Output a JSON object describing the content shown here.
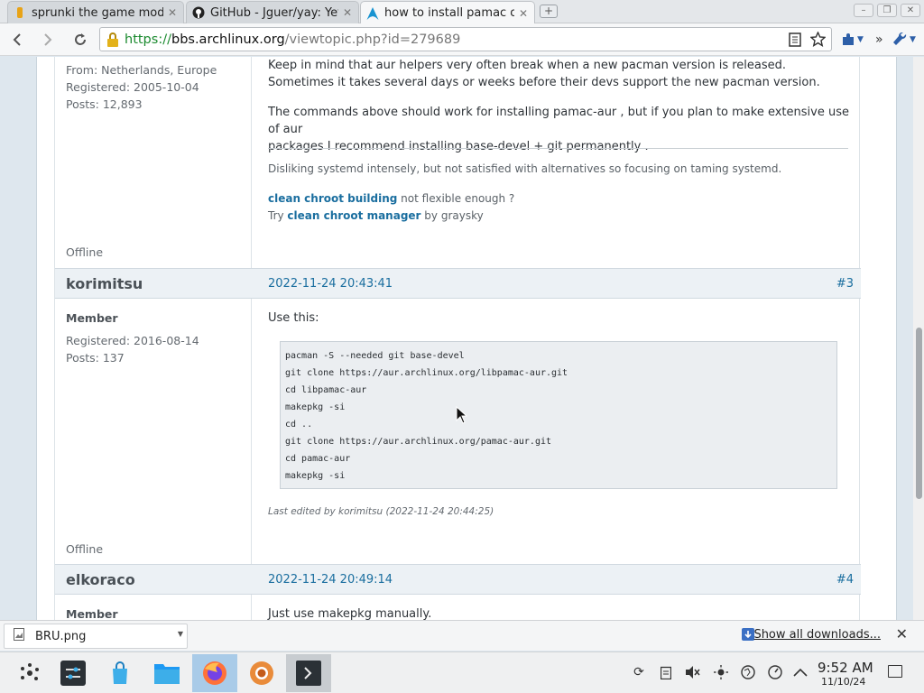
{
  "tabs": [
    {
      "title": "sprunki the game mod",
      "icon": "sprunki-favicon",
      "active": false
    },
    {
      "title": "GitHub - Jguer/yay: Yet",
      "icon": "github-icon",
      "active": false
    },
    {
      "title": "how to install pamac or",
      "icon": "archlinux-icon",
      "active": true
    }
  ],
  "address": {
    "scheme": "https://",
    "host": "bbs.archlinux.org",
    "path": "/viewtopic.php?id=279689"
  },
  "toolbar": {
    "overflow": "»"
  },
  "posts": {
    "p2": {
      "from": "From: Netherlands, Europe",
      "registered": "Registered: 2005-10-04",
      "posts": "Posts: 12,893",
      "status": "Offline",
      "body_line1": "Keep in mind that aur helpers very often break when a new pacman version is released.",
      "body_line2": "Sometimes it takes several days or weeks before their devs support the new pacman version.",
      "body_para2_line1": "The commands above should work for installing pamac-aur , but if you plan to make extensive use of aur",
      "body_para2_line2": "packages I recommend installing base-devel + git permanently .",
      "sig_line1": "Disliking systemd intensely, but not satisfied with alternatives so focusing on taming systemd.",
      "sig_link1": "clean chroot building",
      "sig_text1": " not flexible enough ?",
      "sig_try": "Try ",
      "sig_link2": "clean chroot manager",
      "sig_text2": " by graysky"
    },
    "p3": {
      "author": "korimitsu",
      "date": "2022-11-24 20:43:41",
      "number": "#3",
      "title": "Member",
      "registered": "Registered: 2016-08-14",
      "posts": "Posts: 137",
      "status": "Offline",
      "intro": "Use this:",
      "code": [
        "pacman -S --needed git base-devel",
        "git clone https://aur.archlinux.org/libpamac-aur.git",
        "cd libpamac-aur",
        "makepkg -si",
        "cd ..",
        "git clone https://aur.archlinux.org/pamac-aur.git",
        "cd pamac-aur",
        "makepkg -si"
      ],
      "edited": "Last edited by korimitsu (2022-11-24 20:44:25)"
    },
    "p4": {
      "author": "elkoraco",
      "date": "2022-11-24 20:49:14",
      "number": "#4",
      "title": "Member",
      "body": "Just use makepkg manually."
    }
  },
  "downloads": {
    "file": "BRU.png",
    "show_all": "Show all downloads..."
  },
  "clock": {
    "time": "9:52 AM",
    "date": "11/10/24"
  },
  "taskbar": {
    "apps": [
      "kde-launcher-icon",
      "system-settings-icon",
      "discover-icon",
      "dolphin-icon",
      "firefox-icon",
      "chromium-icon",
      "konsole-icon"
    ],
    "active_app": "firefox-icon"
  }
}
